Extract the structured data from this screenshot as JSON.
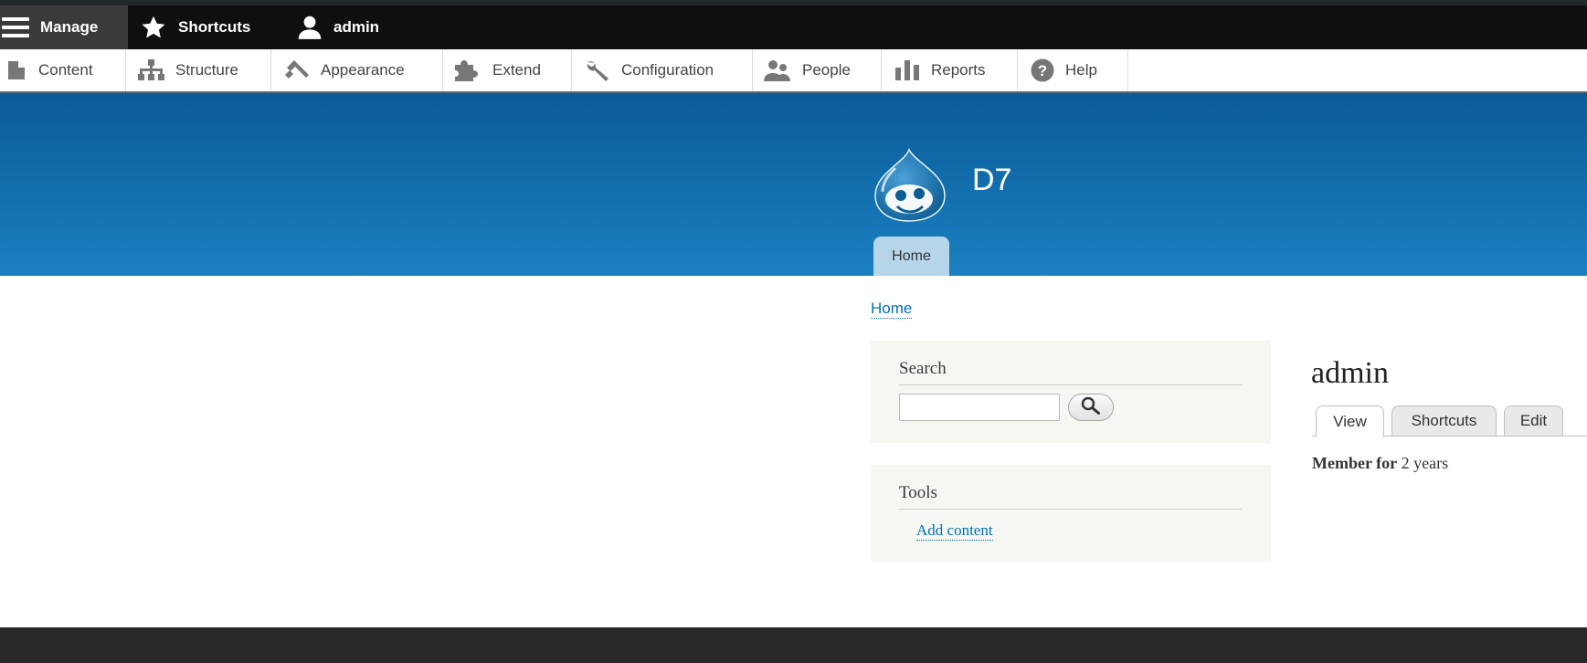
{
  "toolbar": {
    "manage_label": "Manage",
    "shortcuts_label": "Shortcuts",
    "user_label": "admin",
    "bg_color": "#0f0f0f"
  },
  "tray": {
    "items": [
      {
        "label": "Content",
        "icon": "file-icon"
      },
      {
        "label": "Structure",
        "icon": "sitemap-icon"
      },
      {
        "label": "Appearance",
        "icon": "paintbrush-icon"
      },
      {
        "label": "Extend",
        "icon": "puzzle-icon"
      },
      {
        "label": "Configuration",
        "icon": "wrench-icon"
      },
      {
        "label": "People",
        "icon": "people-icon"
      },
      {
        "label": "Reports",
        "icon": "bar-chart-icon"
      },
      {
        "label": "Help",
        "icon": "help-icon"
      }
    ]
  },
  "header": {
    "site_name": "D7",
    "nav_home": "Home",
    "gradient_top": "#0a5b97",
    "gradient_bottom": "#1b80c1"
  },
  "breadcrumb": {
    "home": "Home"
  },
  "sidebar": {
    "search": {
      "title": "Search",
      "input_value": "",
      "button_icon": "search-icon"
    },
    "tools": {
      "title": "Tools",
      "add_content": "Add content"
    }
  },
  "main": {
    "title": "admin",
    "tabs": [
      "View",
      "Shortcuts",
      "Edit"
    ],
    "active_tab": "View",
    "member_label": "Member for",
    "member_value": " 2 years"
  },
  "colors": {
    "link": "#0071b3",
    "footer": "#292929"
  }
}
